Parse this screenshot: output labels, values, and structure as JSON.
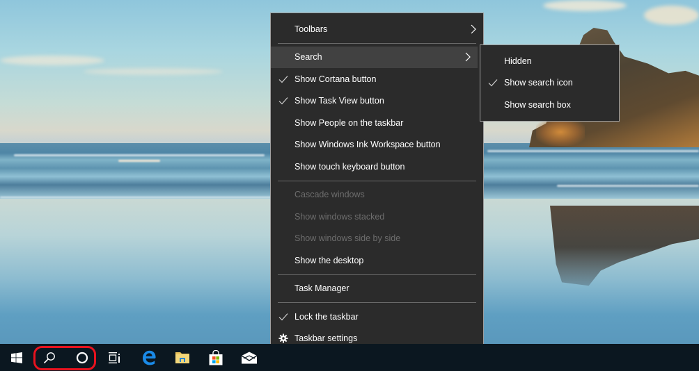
{
  "desktop": {
    "wallpaper": "beach-with-rock-formation"
  },
  "context_menu": {
    "items": [
      {
        "label": "Toolbars",
        "has_submenu": true
      },
      {
        "label": "Search",
        "has_submenu": true,
        "highlighted": true
      },
      {
        "label": "Show Cortana button",
        "checked": true
      },
      {
        "label": "Show Task View button",
        "checked": true
      },
      {
        "label": "Show People on the taskbar"
      },
      {
        "label": "Show Windows Ink Workspace button"
      },
      {
        "label": "Show touch keyboard button"
      },
      {
        "label": "Cascade windows",
        "disabled": true
      },
      {
        "label": "Show windows stacked",
        "disabled": true
      },
      {
        "label": "Show windows side by side",
        "disabled": true
      },
      {
        "label": "Show the desktop"
      },
      {
        "label": "Task Manager"
      },
      {
        "label": "Lock the taskbar",
        "checked": true
      },
      {
        "label": "Taskbar settings",
        "icon": "gear-icon"
      }
    ]
  },
  "search_submenu": {
    "items": [
      {
        "label": "Hidden"
      },
      {
        "label": "Show search icon",
        "checked": true
      },
      {
        "label": "Show search box"
      }
    ]
  },
  "taskbar": {
    "buttons": [
      {
        "name": "start",
        "icon": "windows-logo-icon"
      },
      {
        "name": "search",
        "icon": "search-icon"
      },
      {
        "name": "cortana",
        "icon": "cortana-circle-icon"
      },
      {
        "name": "task-view",
        "icon": "task-view-icon"
      },
      {
        "name": "edge",
        "icon": "edge-icon"
      },
      {
        "name": "file-explorer",
        "icon": "folder-icon"
      },
      {
        "name": "store",
        "icon": "store-bag-icon"
      },
      {
        "name": "mail",
        "icon": "mail-icon"
      }
    ],
    "highlight_color": "#e8121e"
  },
  "colors": {
    "menu_bg": "#2b2b2b",
    "menu_hover": "#414141",
    "menu_text": "#ffffff",
    "menu_disabled_text": "#6d6d6d",
    "taskbar_bg": "#0b1720"
  }
}
